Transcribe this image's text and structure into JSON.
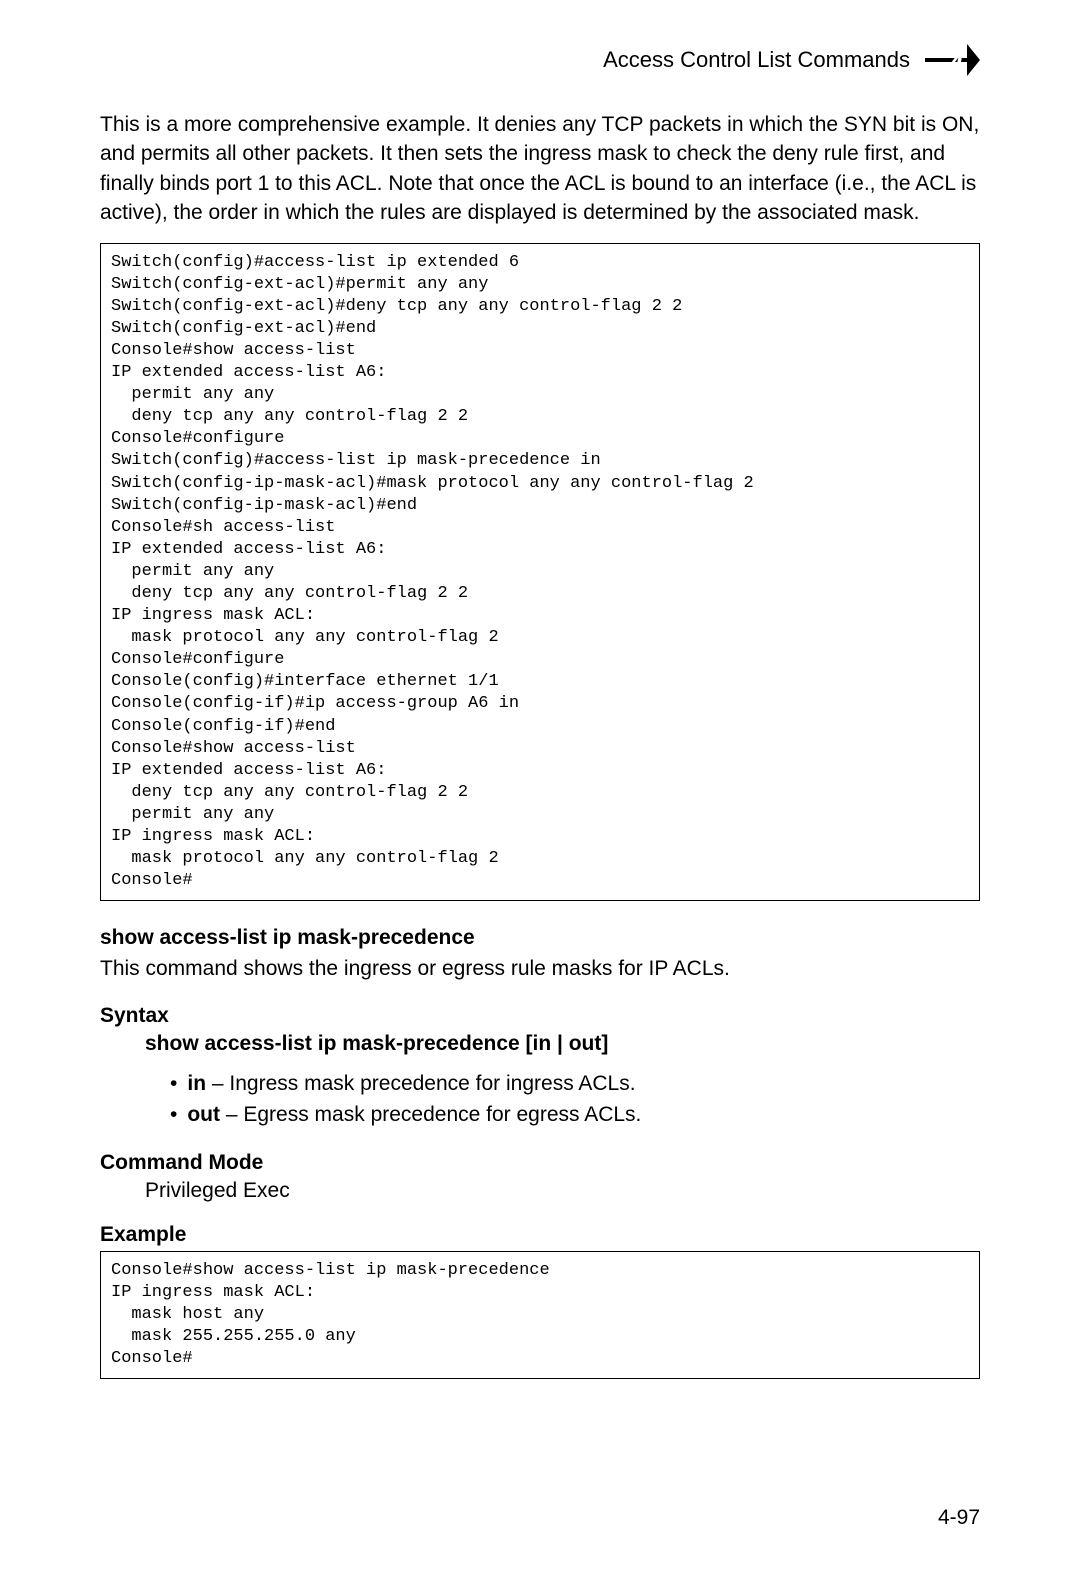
{
  "header": {
    "title": "Access Control List Commands",
    "chapter_number": "4"
  },
  "intro": "This is a more comprehensive example. It denies any TCP packets in which the SYN bit is ON, and permits all other packets. It then sets the ingress mask to check the deny rule first, and finally binds port 1 to this ACL. Note that once the ACL is bound to an interface (i.e., the ACL is active), the order in which the rules are displayed is determined by the associated mask.",
  "code1": "Switch(config)#access-list ip extended 6\nSwitch(config-ext-acl)#permit any any\nSwitch(config-ext-acl)#deny tcp any any control-flag 2 2\nSwitch(config-ext-acl)#end\nConsole#show access-list\nIP extended access-list A6:\n  permit any any\n  deny tcp any any control-flag 2 2\nConsole#configure\nSwitch(config)#access-list ip mask-precedence in\nSwitch(config-ip-mask-acl)#mask protocol any any control-flag 2\nSwitch(config-ip-mask-acl)#end\nConsole#sh access-list\nIP extended access-list A6:\n  permit any any\n  deny tcp any any control-flag 2 2\nIP ingress mask ACL:\n  mask protocol any any control-flag 2\nConsole#configure\nConsole(config)#interface ethernet 1/1\nConsole(config-if)#ip access-group A6 in\nConsole(config-if)#end\nConsole#show access-list\nIP extended access-list A6:\n  deny tcp any any control-flag 2 2\n  permit any any\nIP ingress mask ACL:\n  mask protocol any any control-flag 2\nConsole#",
  "command": {
    "name": "show access-list ip mask-precedence",
    "description": "This command shows the ingress or egress rule masks for IP ACLs."
  },
  "syntax": {
    "heading": "Syntax",
    "line": "show access-list ip mask-precedence [in | out]",
    "bullets": [
      {
        "key": "in",
        "desc": " – Ingress mask precedence for ingress ACLs."
      },
      {
        "key": "out",
        "desc": " – Egress mask precedence for egress ACLs."
      }
    ]
  },
  "command_mode": {
    "heading": "Command Mode",
    "text": "Privileged Exec"
  },
  "example": {
    "heading": "Example",
    "code": "Console#show access-list ip mask-precedence\nIP ingress mask ACL:\n  mask host any\n  mask 255.255.255.0 any\nConsole#"
  },
  "page_number": "4-97"
}
